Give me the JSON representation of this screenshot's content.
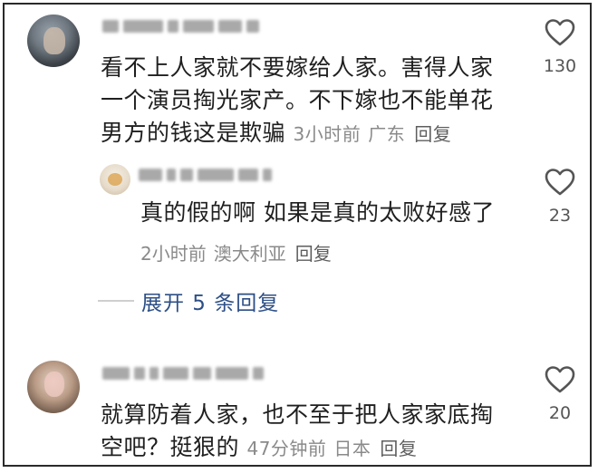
{
  "comments": [
    {
      "text_lines": [
        "看不上人家就不要嫁给人家。害得人家",
        "一个演员掏光家产。不下嫁也不能单花",
        "男方的钱这是欺骗"
      ],
      "time": "3小时前",
      "location": "广东",
      "reply_label": "回复",
      "likes": "130"
    },
    {
      "text_lines": [
        "真的假的啊 如果是真的太败好感了"
      ],
      "time": "2小时前",
      "location": "澳大利亚",
      "reply_label": "回复",
      "likes": "23"
    },
    {
      "text_lines": [
        "就算防着人家，也不至于把人家家底掏",
        "空吧？挺狠的"
      ],
      "time": "47分钟前",
      "location": "日本",
      "reply_label": "回复",
      "likes": "20"
    }
  ],
  "expand_replies": {
    "label": "展开 5 条回复"
  }
}
